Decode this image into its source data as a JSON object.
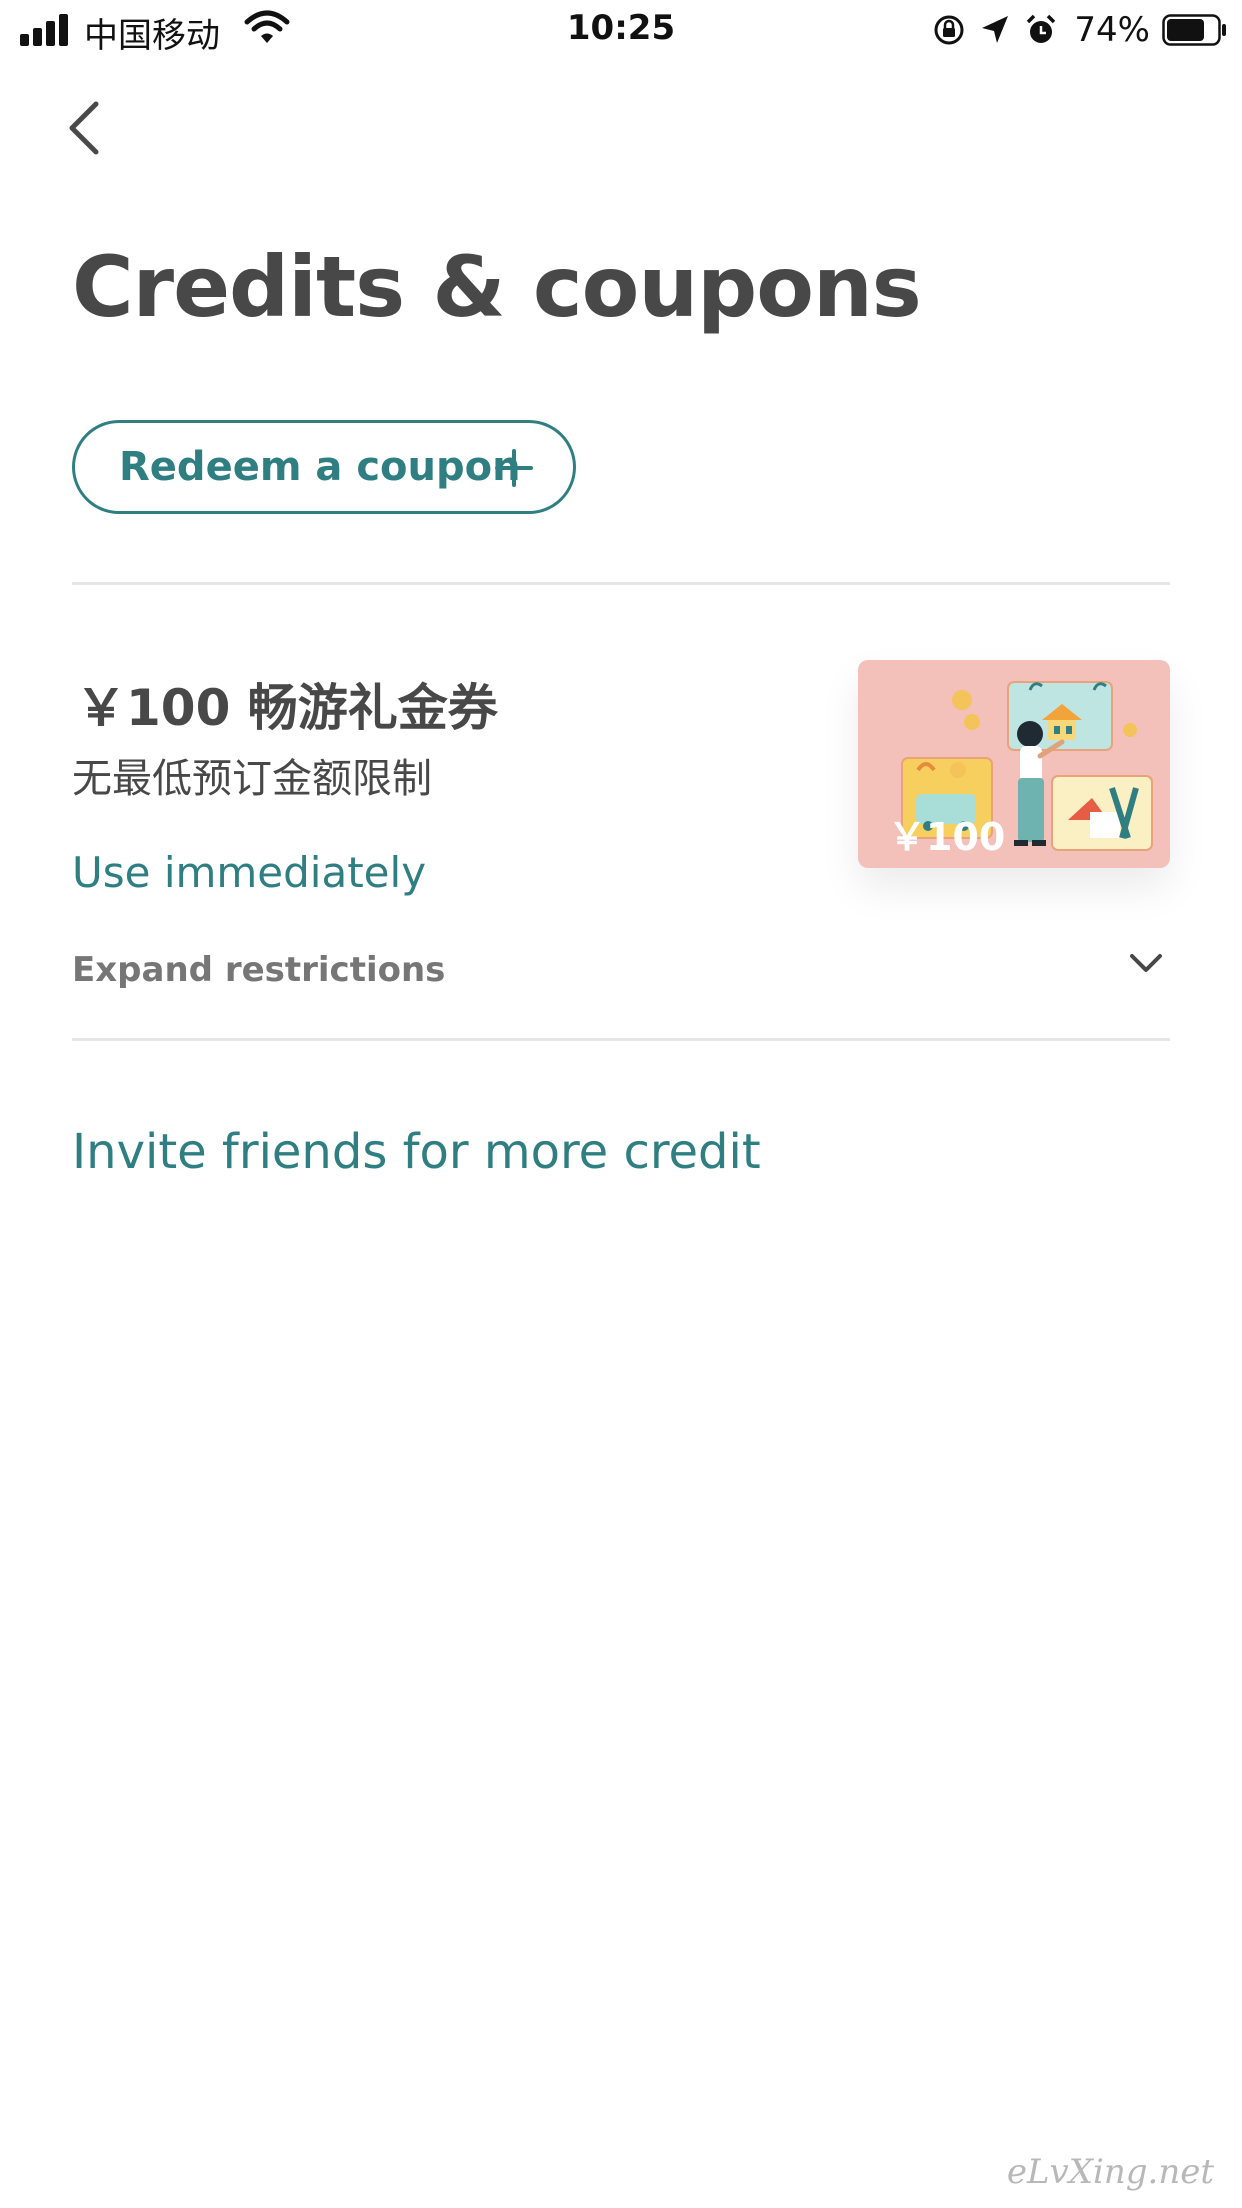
{
  "status_bar": {
    "carrier": "中国移动",
    "time": "10:25",
    "battery": "74%",
    "battery_level": 0.74
  },
  "nav": {
    "back_icon": "chevron-left-icon"
  },
  "page": {
    "title": "Credits & coupons"
  },
  "redeem": {
    "label": "Redeem a coupon",
    "icon": "plus-icon"
  },
  "coupon": {
    "title": "￥100 畅游礼金券",
    "subtitle": "无最低预订金额限制",
    "action": "Use immediately",
    "expand_label": "Expand restrictions",
    "expand_icon": "chevron-down-icon",
    "card_amount": "￥100",
    "card_color": "#f3c0ba"
  },
  "invite": {
    "label": "Invite friends for more credit"
  },
  "watermark": "eLvXing.net",
  "colors": {
    "accent": "#2f7f82",
    "text": "#484848",
    "muted": "#767676",
    "divider": "#e6e6e6"
  }
}
